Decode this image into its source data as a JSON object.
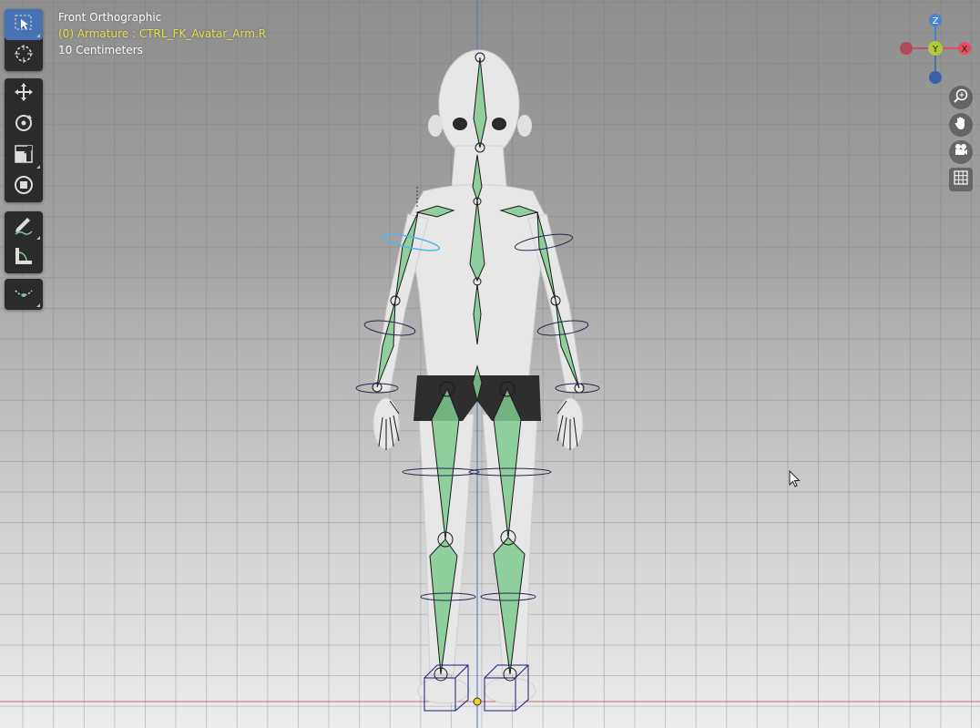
{
  "viewport": {
    "view_name": "Front Orthographic",
    "active_object": "(0) Armature : CTRL_FK_Avatar_Arm.R",
    "grid_scale": "10 Centimeters"
  },
  "toolbar": {
    "tools": [
      {
        "name": "select-box-tool",
        "icon": "select-box-icon",
        "active": true
      },
      {
        "name": "cursor-tool",
        "icon": "cursor-crosshair-icon",
        "active": false
      },
      {
        "name": "move-tool",
        "icon": "move-arrows-icon",
        "active": false
      },
      {
        "name": "rotate-tool",
        "icon": "rotate-icon",
        "active": false
      },
      {
        "name": "scale-tool",
        "icon": "scale-icon",
        "active": false
      },
      {
        "name": "transform-tool",
        "icon": "transform-icon",
        "active": false
      },
      {
        "name": "annotate-tool",
        "icon": "pencil-icon",
        "active": false
      },
      {
        "name": "measure-tool",
        "icon": "ruler-icon",
        "active": false
      },
      {
        "name": "roll-tool",
        "icon": "bone-roll-icon",
        "active": false
      }
    ]
  },
  "gizmo": {
    "axis_z": "Z",
    "axis_y": "Y",
    "axis_x": "X",
    "colors": {
      "x": "#e84a5f",
      "y": "#b3c93a",
      "z": "#4a82d4"
    }
  },
  "navigation": [
    {
      "name": "zoom-button",
      "icon": "zoom-icon"
    },
    {
      "name": "pan-button",
      "icon": "hand-icon"
    },
    {
      "name": "camera-view-button",
      "icon": "camera-icon"
    },
    {
      "name": "ortho-toggle-button",
      "icon": "grid-icon"
    }
  ],
  "colors": {
    "bone_fill": "#7fc98f",
    "active_tool": "#4772b3",
    "info_text_highlight": "#e8e04a"
  }
}
